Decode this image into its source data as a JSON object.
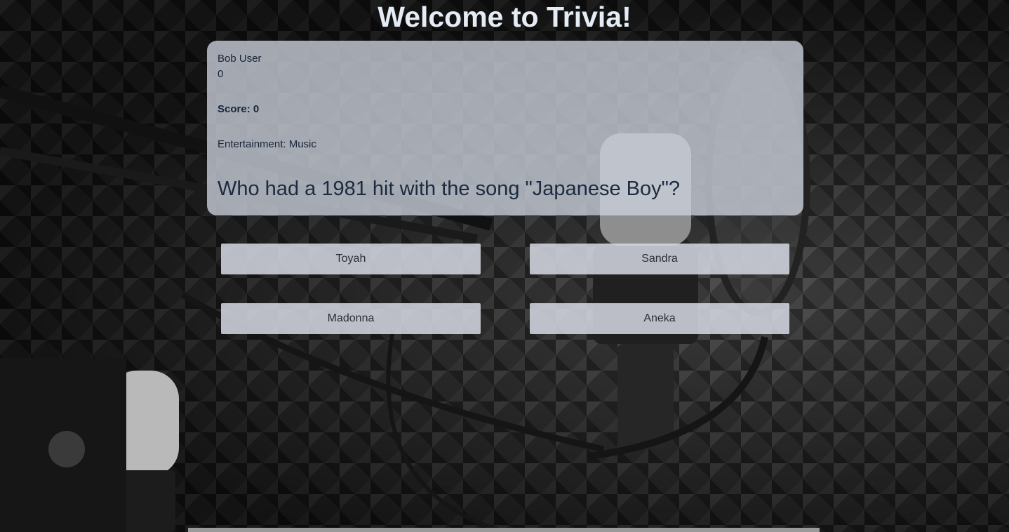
{
  "header": {
    "title": "Welcome to Trivia!"
  },
  "player": {
    "name": "Bob User",
    "id": "0",
    "score_label": "Score: ",
    "score_value": "0"
  },
  "question": {
    "category": "Entertainment: Music",
    "text": "Who had a 1981 hit with the song \"Japanese Boy\"?"
  },
  "answers": [
    {
      "label": "Toyah"
    },
    {
      "label": "Sandra"
    },
    {
      "label": "Madonna"
    },
    {
      "label": "Aneka"
    }
  ],
  "background": {
    "icon": "microphone-studio-icon"
  },
  "colors": {
    "title": "#e6ecf5",
    "card": "#cdd2dc",
    "text": "#17263a"
  }
}
